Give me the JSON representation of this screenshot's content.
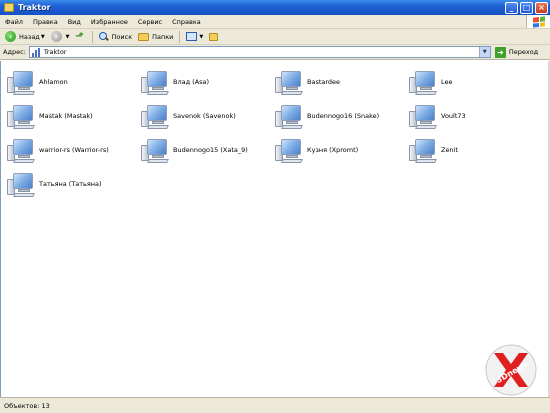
{
  "window": {
    "title": "Traktor"
  },
  "menu": {
    "items": [
      "Файл",
      "Правка",
      "Вид",
      "Избранное",
      "Сервис",
      "Справка"
    ]
  },
  "toolbar": {
    "back_label": "Назад",
    "search_label": "Поиск",
    "folders_label": "Папки"
  },
  "address": {
    "label": "Адрес:",
    "value": "Traktor",
    "go_label": "Переход"
  },
  "items": [
    "Ahlamon",
    "Влад (Asa)",
    "Bastardee",
    "Lee",
    "Mastak (Mastak)",
    "Savenok (Savenok)",
    "Budennogo16 (Snake)",
    "Voult73",
    "warrior-rs (Warrior-rs)",
    "Budennogo15 (Xata_9)",
    "Кузня (Xpromt)",
    "Zenit",
    "Татьяна (Татьяна)"
  ],
  "status": {
    "text": "Объектов: 13"
  },
  "watermark": {
    "text": "3Dnews"
  },
  "colors": {
    "titlebar": "#1f60d6",
    "chrome": "#ece9d8",
    "accent": "#e02020"
  }
}
